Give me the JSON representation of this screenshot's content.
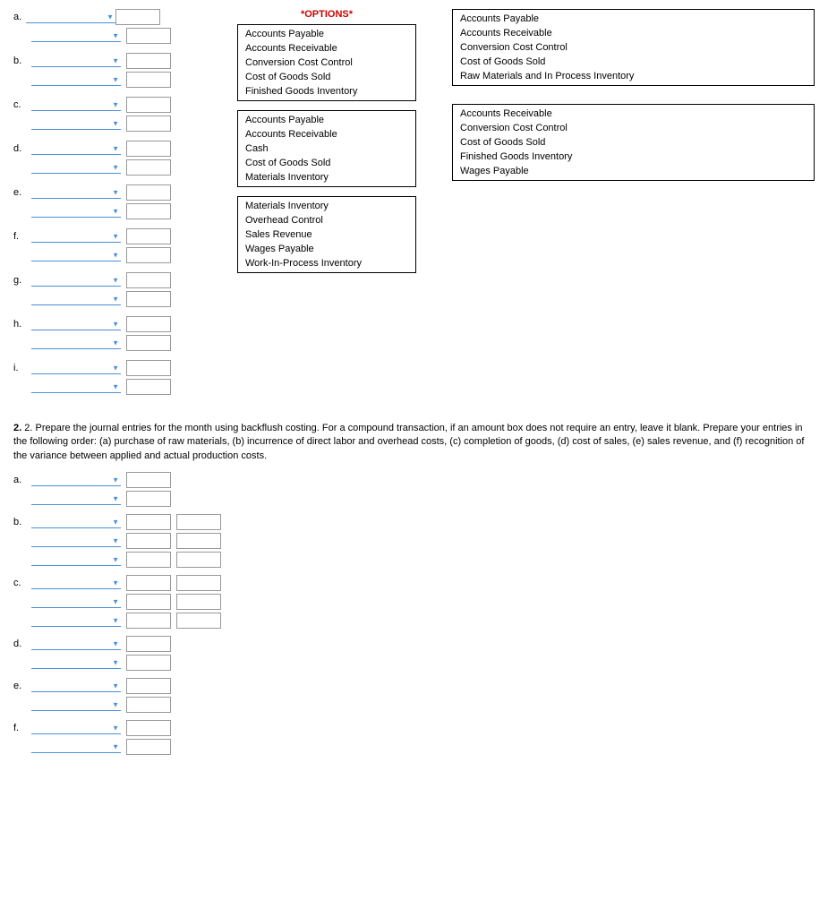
{
  "options_title": "*OPTIONS*",
  "options_box1": {
    "items": [
      "Accounts Payable",
      "Accounts Receivable",
      "Conversion Cost Control",
      "Cost of Goods Sold",
      "Finished Goods Inventory"
    ]
  },
  "options_box2": {
    "items": [
      "Accounts Payable",
      "Accounts Receivable",
      "Cash",
      "Cost of Goods Sold",
      "Materials Inventory"
    ]
  },
  "options_box3": {
    "items": [
      "Materials Inventory",
      "Overhead Control",
      "Sales Revenue",
      "Wages Payable",
      "Work-In-Process Inventory"
    ]
  },
  "right_box1": {
    "items": [
      "Accounts Payable",
      "Accounts Receivable",
      "Conversion Cost Control",
      "Cost of Goods Sold",
      "Raw Materials and In Process Inventory"
    ]
  },
  "right_box2": {
    "items": [
      "Accounts Receivable",
      "Conversion Cost Control",
      "Cost of Goods Sold",
      "Finished Goods Inventory",
      "Wages Payable"
    ]
  },
  "section2_text": "2. Prepare the journal entries for the month using backflush costing. For a compound transaction, if an amount box does not require an entry, leave it blank. Prepare your entries in the following order: (a) purchase of raw materials, (b) incurrence of direct labor and overhead costs, (c) completion of goods, (d) cost of sales, (e) sales revenue, and (f) recognition of the variance between applied and actual production costs.",
  "section1_labels": [
    "a.",
    "b.",
    "c.",
    "d.",
    "e.",
    "f.",
    "g.",
    "h.",
    "i."
  ],
  "section2_labels": [
    "a.",
    "b.",
    "c.",
    "d.",
    "e.",
    "f."
  ]
}
